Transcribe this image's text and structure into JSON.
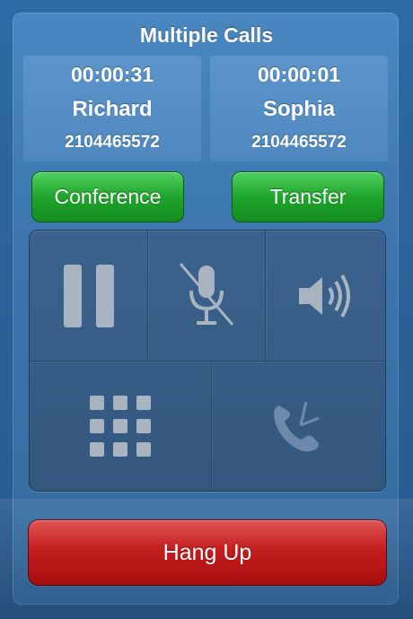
{
  "title": "Multiple Calls",
  "calls": [
    {
      "duration": "00:00:31",
      "name": "Richard",
      "number": "2104465572"
    },
    {
      "duration": "00:00:01",
      "name": "Sophia",
      "number": "2104465572"
    }
  ],
  "actions": {
    "conference_label": "Conference",
    "transfer_label": "Transfer"
  },
  "controls": {
    "hold_icon": "pause-icon",
    "mute_icon": "mic-muted-icon",
    "speaker_icon": "speaker-icon",
    "keypad_icon": "keypad-icon",
    "add_call_icon": "phone-add-icon"
  },
  "hangup_label": "Hang Up",
  "colors": {
    "accent_green": "#1fa52c",
    "hangup_red": "#c41e1e",
    "background_blue": "#2a5f95"
  }
}
